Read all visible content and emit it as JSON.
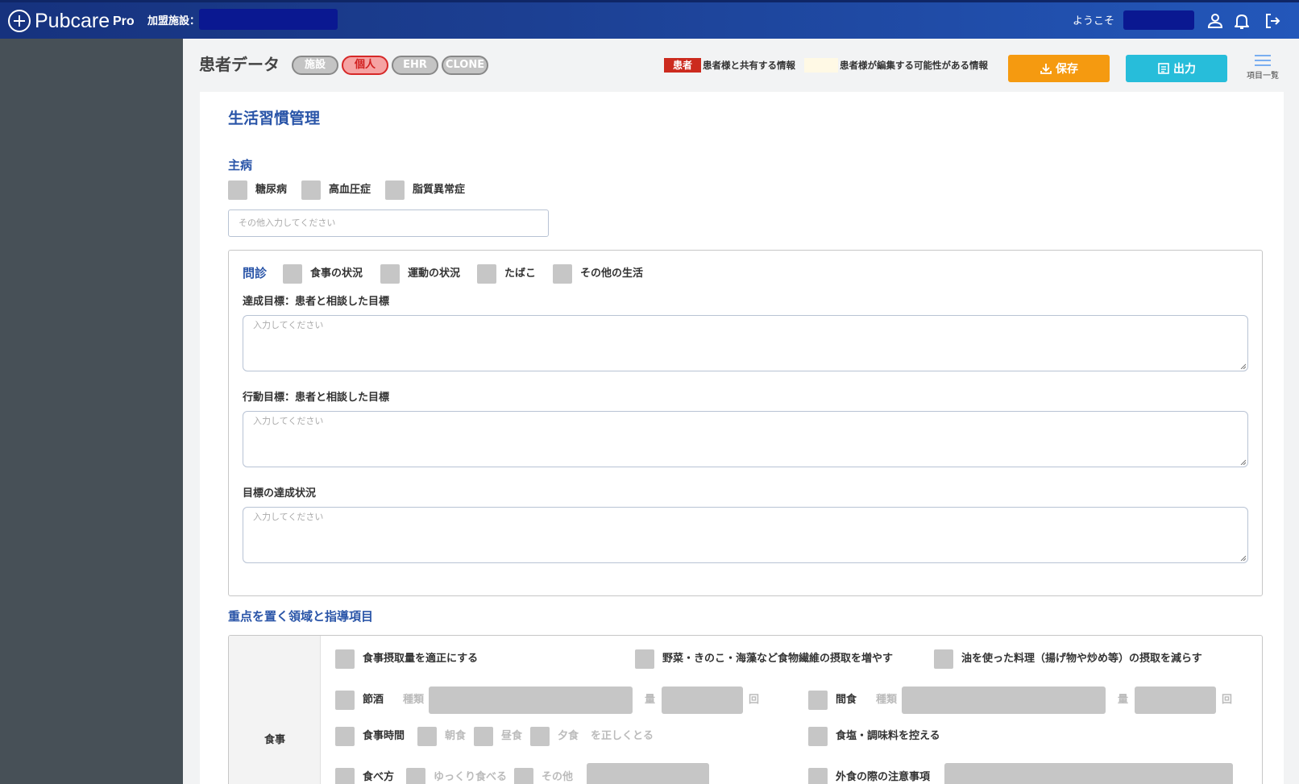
{
  "header": {
    "logo_text": "Pubcare",
    "logo_pro": "Pro",
    "facility_label": "加盟施設：",
    "welcome": "ようこそ"
  },
  "toolbar": {
    "page_title": "患者データ",
    "tags": [
      "施設",
      "個人",
      "EHR",
      "CLONE"
    ],
    "active_tag": "個人",
    "legend_badge": "患者",
    "legend_shared": "患者様と共有する情報",
    "legend_editable": "患者様が編集する可能性がある情報",
    "save_label": "保存",
    "output_label": "出力",
    "menu_label": "項目一覧"
  },
  "form": {
    "title": "生活習慣管理",
    "main_disease": {
      "heading": "主病",
      "options": [
        "糖尿病",
        "高血圧症",
        "脂質異常症"
      ],
      "other_placeholder": "その他入力してください"
    },
    "interview": {
      "heading": "問診",
      "options": [
        "食事の状況",
        "運動の状況",
        "たばこ",
        "その他の生活"
      ],
      "fields": [
        {
          "label": "達成目標：患者と相談した目標",
          "placeholder": "入力してください"
        },
        {
          "label": "行動目標：患者と相談した目標",
          "placeholder": "入力してください"
        },
        {
          "label": "目標の達成状況",
          "placeholder": "入力してください"
        }
      ]
    },
    "focus": {
      "heading": "重点を置く領域と指導項目",
      "category": "食事",
      "row1": [
        "食事摂取量を適正にする",
        "野菜・きのこ・海藻など食物繊維の摂取を増やす",
        "油を使った料理（揚げ物や炒め等）の摂取を減らす"
      ],
      "row2": {
        "drink": "節酒",
        "drink_kind": "種類",
        "drink_amount": "量",
        "drink_unit": "回",
        "snack": "間食",
        "snack_kind": "種類",
        "snack_amount": "量",
        "snack_unit": "回"
      },
      "row3": {
        "meal_time": "食事時間",
        "breakfast": "朝食",
        "lunch": "昼食",
        "dinner": "夕食",
        "suffix": "を正しくとる",
        "salt": "食塩・調味料を控える"
      },
      "row4": {
        "eating": "食べ方",
        "slowly": "ゆっくり食べる",
        "other": "その他",
        "eating_out": "外食の際の注意事項"
      }
    }
  },
  "colors": {
    "header_start": "#16327e",
    "header_end": "#2357ba",
    "sidebar": "#475057",
    "accent_blue": "#2a55a8",
    "save": "#f59a10",
    "output": "#27bdda",
    "legend_red": "#cc2a1e"
  }
}
